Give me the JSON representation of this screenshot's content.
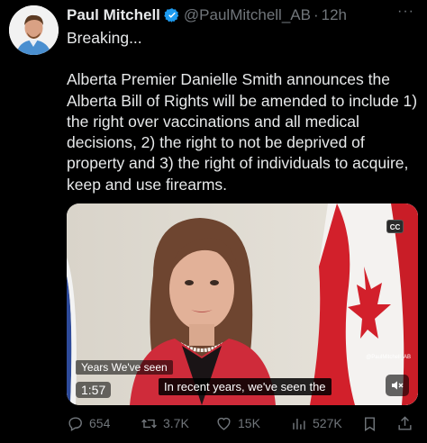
{
  "author": {
    "name": "Paul Mitchell",
    "handle": "@PaulMitchell_AB",
    "separator": "·",
    "time": "12h"
  },
  "menu": {
    "more_label": "···"
  },
  "tweet": {
    "line1": "Breaking...",
    "line2": "Alberta Premier Danielle Smith announces the Alberta Bill of Rights will be amended to include 1) the right over vaccinations and all medical decisions, 2) the right to not be deprived of property and 3) the right of individuals to acquire, keep and use firearms."
  },
  "video": {
    "cc_label": "CC",
    "caption_small": "Years We've seen",
    "caption_main": "In recent years, we've seen the",
    "duration": "1:57",
    "watermark": "@PaulMitchell_AB"
  },
  "actions": {
    "replies": "654",
    "reposts": "3.7K",
    "likes": "15K",
    "views": "527K"
  },
  "colors": {
    "background": "#000000",
    "text": "#e7e9ea",
    "muted": "#71767b",
    "verified": "#1d9bf0"
  }
}
